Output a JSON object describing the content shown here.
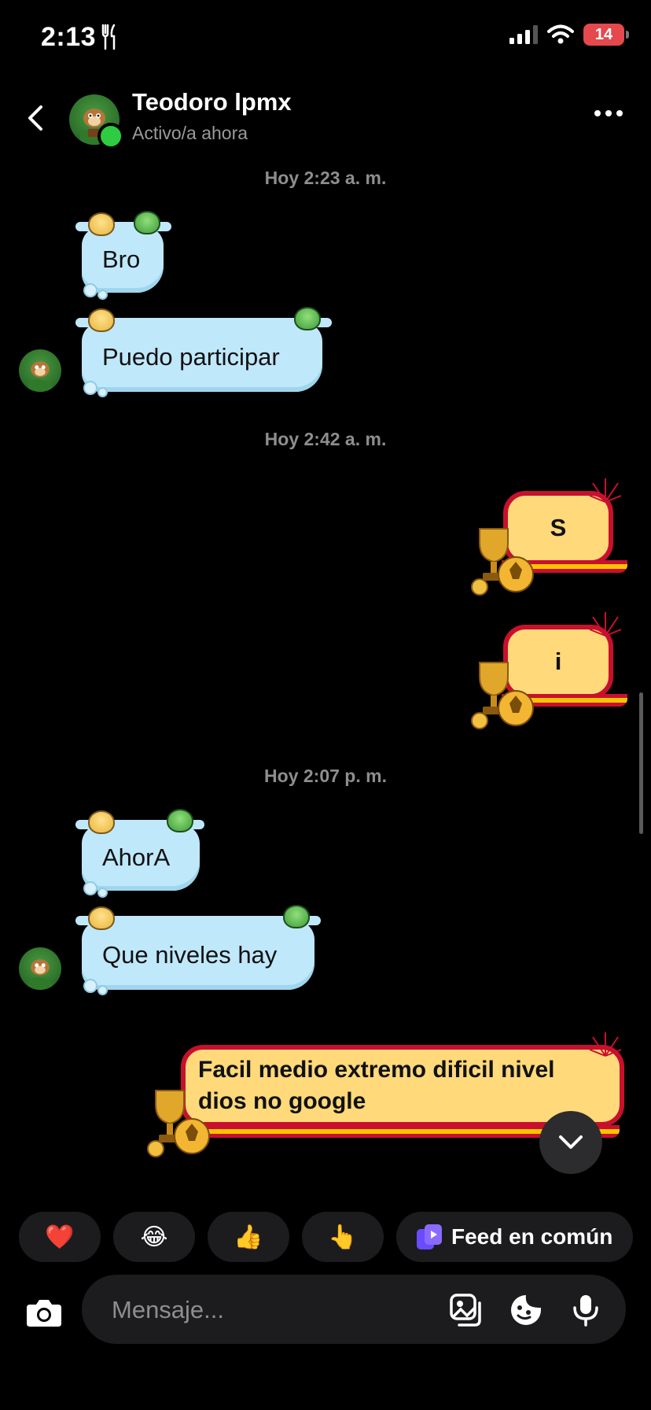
{
  "status_bar": {
    "time": "2:13",
    "battery": "14"
  },
  "header": {
    "contact_name": "Teodoro lpmx",
    "presence": "Activo/a ahora"
  },
  "timestamps": [
    "Hoy 2:23 a. m.",
    "Hoy 2:42 a. m.",
    "Hoy 2:07 p. m."
  ],
  "messages": [
    {
      "from": "contact",
      "text": "Bro"
    },
    {
      "from": "contact",
      "text": "Puedo participar"
    },
    {
      "from": "me",
      "text": "S"
    },
    {
      "from": "me",
      "text": "i"
    },
    {
      "from": "contact",
      "text": "AhorA"
    },
    {
      "from": "contact",
      "text": "Que niveles hay"
    },
    {
      "from": "me",
      "text": "Facil medio extremo dificil nivel dios no google"
    }
  ],
  "quick_replies": {
    "emojis": [
      "❤️",
      "😂",
      "👍",
      "👆"
    ],
    "feed_label": "Feed en común"
  },
  "composer": {
    "placeholder": "Mensaje..."
  },
  "colors": {
    "incoming_bubble": "#bfe8fb",
    "outgoing_bubble": "#ffd97a",
    "outgoing_border": "#c8102e",
    "online": "#2ecc40"
  }
}
